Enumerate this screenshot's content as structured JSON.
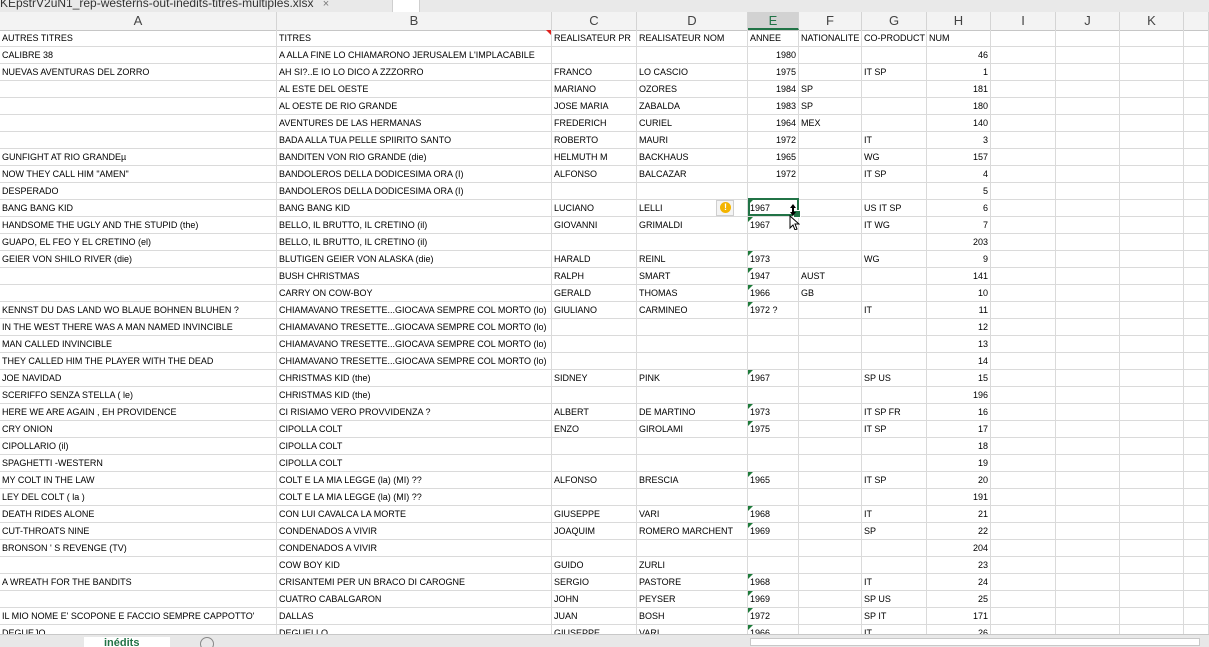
{
  "window": {
    "file_tab": "KEpstrV2uN1_rep-westerns-out-inedits-titres-multiples.xlsx",
    "close_glyph": "×"
  },
  "columns": [
    "A",
    "B",
    "C",
    "D",
    "E",
    "F",
    "G",
    "H",
    "I",
    "J",
    "K"
  ],
  "active_column": "E",
  "header_row": [
    "AUTRES TITRES",
    "TITRES",
    "REALISATEUR PR",
    "REALISATEUR NOM",
    "ANNEE",
    "NATIONALITE",
    "CO-PRODUCT",
    "NUM"
  ],
  "rows": [
    {
      "a": "CALIBRE 38",
      "b": "A ALLA FINE LO CHIAMARONO JERUSALEM L'IMPLACABILE",
      "c": "",
      "d": "",
      "e": "1980",
      "f": "",
      "g": "",
      "h": "46"
    },
    {
      "a": "NUEVAS AVENTURAS DEL ZORRO",
      "b": "AH SI?..E IO LO DICO A ZZZORRO",
      "c": "FRANCO",
      "d": "LO CASCIO",
      "e": "1975",
      "f": "",
      "g": "IT SP",
      "h": "1"
    },
    {
      "a": "",
      "b": "AL ESTE DEL OESTE",
      "c": "MARIANO",
      "d": "OZORES",
      "e": "1984",
      "f": "SP",
      "g": "",
      "h": "181"
    },
    {
      "a": "",
      "b": "AL OESTE DE RIO GRANDE",
      "c": "JOSE MARIA",
      "d": "ZABALDA",
      "e": "1983",
      "f": "SP",
      "g": "",
      "h": "180"
    },
    {
      "a": "",
      "b": "AVENTURES DE LAS HERMANAS",
      "c": "FREDERICH",
      "d": "CURIEL",
      "e": "1964",
      "f": "MEX",
      "g": "",
      "h": "140"
    },
    {
      "a": "",
      "b": "BADA ALLA TUA PELLE SPIIRITO SANTO",
      "c": "ROBERTO",
      "d": "MAURI",
      "e": "1972",
      "f": "",
      "g": "IT",
      "h": "3"
    },
    {
      "a": "GUNFIGHT AT RIO GRANDEµ",
      "b": "BANDITEN VON RIO GRANDE (die)",
      "c": "HELMUTH M",
      "d": "BACKHAUS",
      "e": "1965",
      "f": "",
      "g": "WG",
      "h": "157"
    },
    {
      "a": "NOW THEY CALL HIM \"AMEN\"",
      "b": "BANDOLEROS DELLA DODICESIMA ORA (I)",
      "c": "ALFONSO",
      "d": "BALCAZAR",
      "e": "1972",
      "f": "",
      "g": "IT SP",
      "h": "4"
    },
    {
      "a": "DESPERADO",
      "b": "BANDOLEROS DELLA DODICESIMA ORA (I)",
      "c": "",
      "d": "",
      "e": "",
      "f": "",
      "g": "",
      "h": "5"
    },
    {
      "a": "BANG BANG KID",
      "b": "BANG BANG KID",
      "c": "LUCIANO",
      "d": "LELLI",
      "e": "1967",
      "f": "",
      "g": "US IT SP",
      "h": "6"
    },
    {
      "a": "HANDSOME THE UGLY AND THE STUPID (the)",
      "b": "BELLO, IL BRUTTO, IL CRETINO (il)",
      "c": "GIOVANNI",
      "d": "GRIMALDI",
      "e": "1967",
      "f": "",
      "g": "IT WG",
      "h": "7"
    },
    {
      "a": "GUAPO, EL FEO Y EL CRETINO (el)",
      "b": "BELLO, IL BRUTTO, IL CRETINO (il)",
      "c": "",
      "d": "",
      "e": "",
      "f": "",
      "g": "",
      "h": "203"
    },
    {
      "a": "GEIER VON SHILO RIVER (die)",
      "b": "BLUTIGEN GEIER VON ALASKA (die)",
      "c": "HARALD",
      "d": "REINL",
      "e": "1973",
      "f": "",
      "g": "WG",
      "h": "9"
    },
    {
      "a": "",
      "b": "BUSH CHRISTMAS",
      "c": "RALPH",
      "d": "SMART",
      "e": "1947",
      "f": "AUST",
      "g": "",
      "h": "141"
    },
    {
      "a": "",
      "b": "CARRY ON COW-BOY",
      "c": "GERALD",
      "d": "THOMAS",
      "e": "1966",
      "f": "GB",
      "g": "",
      "h": "10"
    },
    {
      "a": "KENNST DU DAS LAND WO BLAUE  BOHNEN BLUHEN ?",
      "b": "CHIAMAVANO TRESETTE...GIOCAVA SEMPRE COL MORTO  (lo)",
      "c": "GIULIANO",
      "d": "CARMINEO",
      "e": "1972 ?",
      "f": "",
      "g": "IT",
      "h": "11"
    },
    {
      "a": "IN THE WEST THERE  WAS  A MAN NAMED INVINCIBLE",
      "b": "CHIAMAVANO TRESETTE...GIOCAVA SEMPRE COL MORTO  (lo)",
      "c": "",
      "d": "",
      "e": "",
      "f": "",
      "g": "",
      "h": "12"
    },
    {
      "a": "MAN CALLED INVINCIBLE",
      "b": "CHIAMAVANO TRESETTE...GIOCAVA SEMPRE COL MORTO  (lo)",
      "c": "",
      "d": "",
      "e": "",
      "f": "",
      "g": "",
      "h": "13"
    },
    {
      "a": "THEY CALLED HIM THE PLAYER WITH THE DEAD",
      "b": "CHIAMAVANO TRESETTE...GIOCAVA SEMPRE COL MORTO  (lo)",
      "c": "",
      "d": "",
      "e": "",
      "f": "",
      "g": "",
      "h": "14"
    },
    {
      "a": "JOE NAVIDAD",
      "b": "CHRISTMAS KID (the)",
      "c": "SIDNEY",
      "d": "PINK",
      "e": "1967",
      "f": "",
      "g": "SP US",
      "h": "15"
    },
    {
      "a": "SCERIFFO SENZA STELLA  ( le)",
      "b": "CHRISTMAS KID (the)",
      "c": "",
      "d": "",
      "e": "",
      "f": "",
      "g": "",
      "h": "196"
    },
    {
      "a": "HERE WE ARE AGAIN , EH PROVIDENCE",
      "b": "CI RISIAMO VERO PROVVIDENZA ?",
      "c": "ALBERT",
      "d": "DE MARTINO",
      "e": "1973",
      "f": "",
      "g": "IT SP FR",
      "h": "16"
    },
    {
      "a": "CRY ONION",
      "b": "CIPOLLA COLT",
      "c": "ENZO",
      "d": "GIROLAMI",
      "e": "1975",
      "f": "",
      "g": "IT SP",
      "h": "17"
    },
    {
      "a": "CIPOLLARIO (il)",
      "b": "CIPOLLA COLT",
      "c": "",
      "d": "",
      "e": "",
      "f": "",
      "g": "",
      "h": "18"
    },
    {
      "a": "SPAGHETTI -WESTERN",
      "b": "CIPOLLA COLT",
      "c": "",
      "d": "",
      "e": "",
      "f": "",
      "g": "",
      "h": "19"
    },
    {
      "a": "MY COLT IN THE LAW",
      "b": "COLT E LA MIA LEGGE (la)          (MI) ??",
      "c": "ALFONSO",
      "d": "BRESCIA",
      "e": "1965",
      "f": "",
      "g": "IT SP",
      "h": "20"
    },
    {
      "a": "LEY DEL COLT ( la )",
      "b": "COLT E LA MIA LEGGE (la)          (MI) ??",
      "c": "",
      "d": "",
      "e": "",
      "f": "",
      "g": "",
      "h": "191"
    },
    {
      "a": "DEATH RIDES ALONE",
      "b": "CON LUI CAVALCA LA MORTE",
      "c": "GIUSEPPE",
      "d": "VARI",
      "e": "1968",
      "f": "",
      "g": "IT",
      "h": "21"
    },
    {
      "a": "CUT-THROATS NINE",
      "b": "CONDENADOS A VIVIR",
      "c": "JOAQUIM",
      "d": "ROMERO MARCHENT",
      "e": "1969",
      "f": "",
      "g": "SP",
      "h": "22"
    },
    {
      "a": "BRONSON ' S REVENGE (TV)",
      "b": "CONDENADOS A VIVIR",
      "c": "",
      "d": "",
      "e": "",
      "f": "",
      "g": "",
      "h": "204"
    },
    {
      "a": "",
      "b": "COW BOY KID",
      "c": "GUIDO",
      "d": "ZURLI",
      "e": "",
      "f": "",
      "g": "",
      "h": "23"
    },
    {
      "a": "A WREATH  FOR THE BANDITS",
      "b": "CRISANTEMI PER UN BRACO DI  CAROGNE",
      "c": "SERGIO",
      "d": "PASTORE",
      "e": "1968",
      "f": "",
      "g": "IT",
      "h": "24"
    },
    {
      "a": "",
      "b": "CUATRO CABALGARON",
      "c": "JOHN",
      "d": "PEYSER",
      "e": "1969",
      "f": "",
      "g": "SP US",
      "h": "25"
    },
    {
      "a": "IL MIO  NOME E' SCOPONE E FACCIO SEMPRE CAPPOTTO'",
      "b": "DALLAS",
      "c": "JUAN",
      "d": "BOSH",
      "e": "1972",
      "f": "",
      "g": "SP IT",
      "h": "171"
    },
    {
      "a": "DEGUEJO",
      "b": "DEGUELLO",
      "c": "GIUSEPPE",
      "d": "VARI",
      "e": "1966",
      "f": "",
      "g": "IT",
      "h": "26"
    }
  ],
  "text_year_rows": [
    9,
    10,
    12,
    13,
    14,
    15,
    19,
    21,
    22,
    25,
    27,
    28,
    31,
    32,
    33,
    34
  ],
  "comment_cell": "B1",
  "warning_glyph": "!",
  "sheet_tab": "inédits"
}
